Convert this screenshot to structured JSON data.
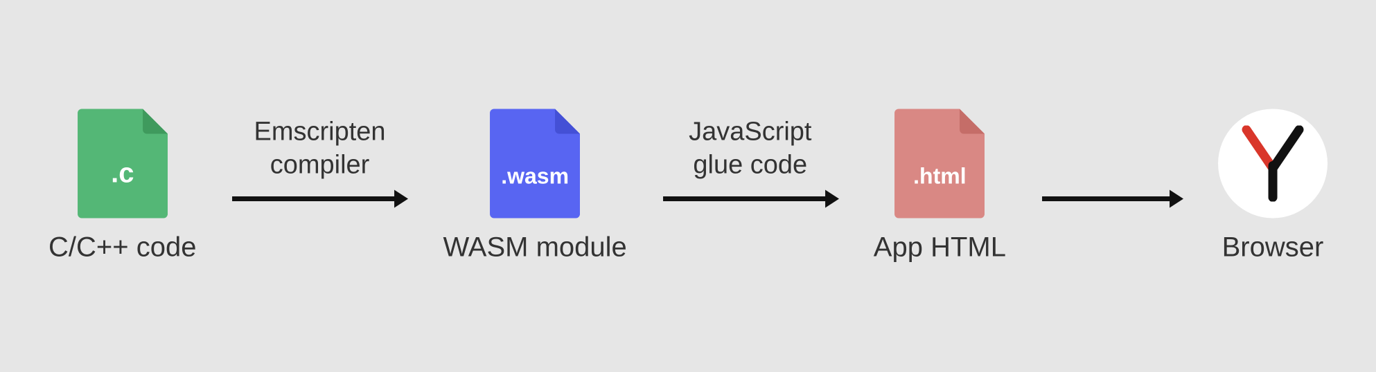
{
  "diagram": {
    "nodes": [
      {
        "id": "c-source",
        "file_label": ".c",
        "caption": "C/C++ code",
        "color_body": "#54b776",
        "color_fold": "#3f9a5d"
      },
      {
        "id": "wasm-module",
        "file_label": ".wasm",
        "caption": "WASM module",
        "color_body": "#5865f2",
        "color_fold": "#4450d6"
      },
      {
        "id": "app-html",
        "file_label": ".html",
        "caption": "App HTML",
        "color_body": "#d98884",
        "color_fold": "#c56d68"
      },
      {
        "id": "browser",
        "caption": "Browser",
        "icon": "yandex-browser"
      }
    ],
    "arrows": [
      {
        "id": "arrow-emscripten",
        "line1": "Emscripten",
        "line2": "compiler"
      },
      {
        "id": "arrow-glue",
        "line1": "JavaScript",
        "line2": "glue code"
      },
      {
        "id": "arrow-to-browser"
      }
    ]
  }
}
